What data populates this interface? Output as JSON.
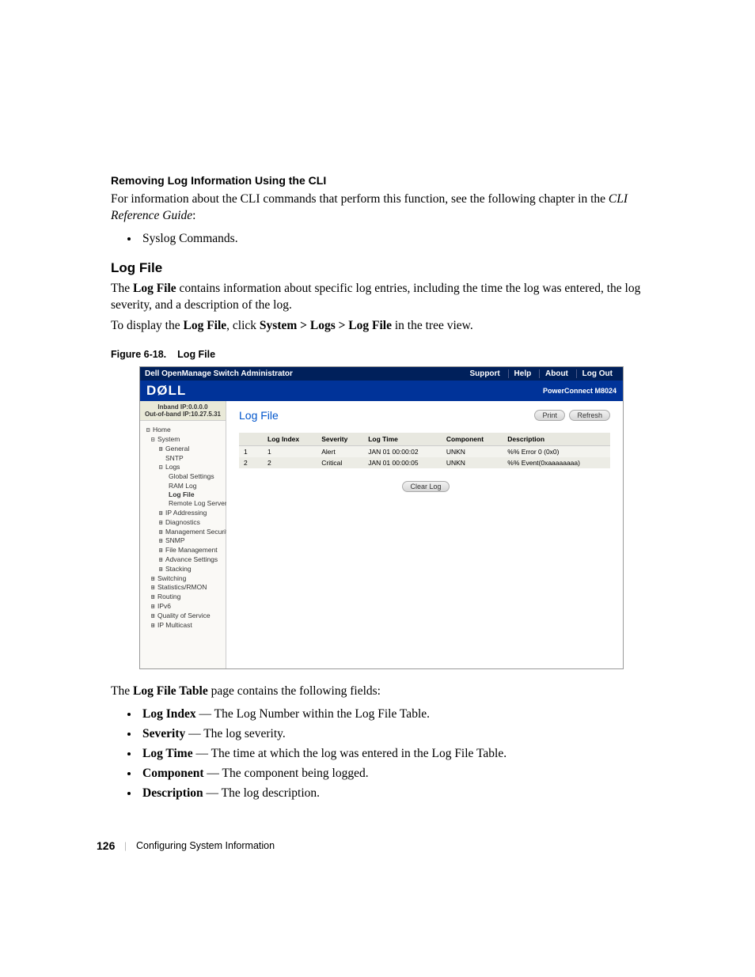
{
  "heading_removing": "Removing Log Information Using the CLI",
  "para_info": "For information about the CLI commands that perform this function, see the following chapter in the ",
  "cli_guide": "CLI Reference Guide",
  "colon": ":",
  "bullet_syslog": "Syslog Commands.",
  "heading_logfile": "Log File",
  "para_logfile_1a": "The ",
  "para_logfile_1b": "Log File",
  "para_logfile_1c": " contains information about specific log entries, including the time the log was entered, the log severity, and a description of the log.",
  "para_logfile_2a": "To display the ",
  "para_logfile_2b": "Log File",
  "para_logfile_2c": ", click ",
  "para_logfile_2d": "System > Logs > Log File",
  "para_logfile_2e": " in the tree view.",
  "figure_label": "Figure 6-18.",
  "figure_title": "Log File",
  "ss": {
    "titlebar_left": "Dell OpenManage Switch Administrator",
    "links": {
      "support": "Support",
      "help": "Help",
      "about": "About",
      "logout": "Log Out"
    },
    "logo_text": "DØLL",
    "product": "PowerConnect M8024",
    "ip_line1": "Inband IP:0.0.0.0",
    "ip_line2": "Out-of-band IP:10.27.5.31",
    "tree": {
      "home": "Home",
      "system": "System",
      "general": "General",
      "sntp": "SNTP",
      "logs": "Logs",
      "global_settings": "Global Settings",
      "ram_log": "RAM Log",
      "log_file": "Log File",
      "remote_log_server": "Remote Log Server",
      "ip_addressing": "IP Addressing",
      "diagnostics": "Diagnostics",
      "mgmt_security": "Management Security",
      "snmp": "SNMP",
      "file_mgmt": "File Management",
      "advance_settings": "Advance Settings",
      "stacking": "Stacking",
      "switching": "Switching",
      "stats_rmon": "Statistics/RMON",
      "routing": "Routing",
      "ipv6": "IPv6",
      "qos": "Quality of Service",
      "ip_multicast": "IP Multicast"
    },
    "main_title": "Log File",
    "buttons": {
      "print": "Print",
      "refresh": "Refresh",
      "clear": "Clear Log"
    },
    "table": {
      "headers": {
        "idx": "Log Index",
        "sev": "Severity",
        "time": "Log Time",
        "comp": "Component",
        "desc": "Description"
      },
      "rows": [
        {
          "n": "1",
          "idx": "1",
          "sev": "Alert",
          "time": "JAN 01 00:00:02",
          "comp": "UNKN",
          "desc": "%% Error 0 (0x0)"
        },
        {
          "n": "2",
          "idx": "2",
          "sev": "Critical",
          "time": "JAN 01 00:00:05",
          "comp": "UNKN",
          "desc": "%% Event(0xaaaaaaaa)"
        }
      ]
    }
  },
  "post_para_a": "The ",
  "post_para_b": "Log File Table",
  "post_para_c": " page contains the following fields:",
  "fields": {
    "log_index_b": "Log Index",
    "log_index_t": " — The Log Number within the Log File Table.",
    "severity_b": "Severity",
    "severity_t": " — The log severity.",
    "log_time_b": "Log Time",
    "log_time_t": " — The time at which the log was entered in the Log File Table.",
    "component_b": "Component",
    "component_t": " — The component being logged.",
    "description_b": "Description",
    "description_t": " — The log description."
  },
  "footer": {
    "page": "126",
    "section": "Configuring System Information"
  }
}
